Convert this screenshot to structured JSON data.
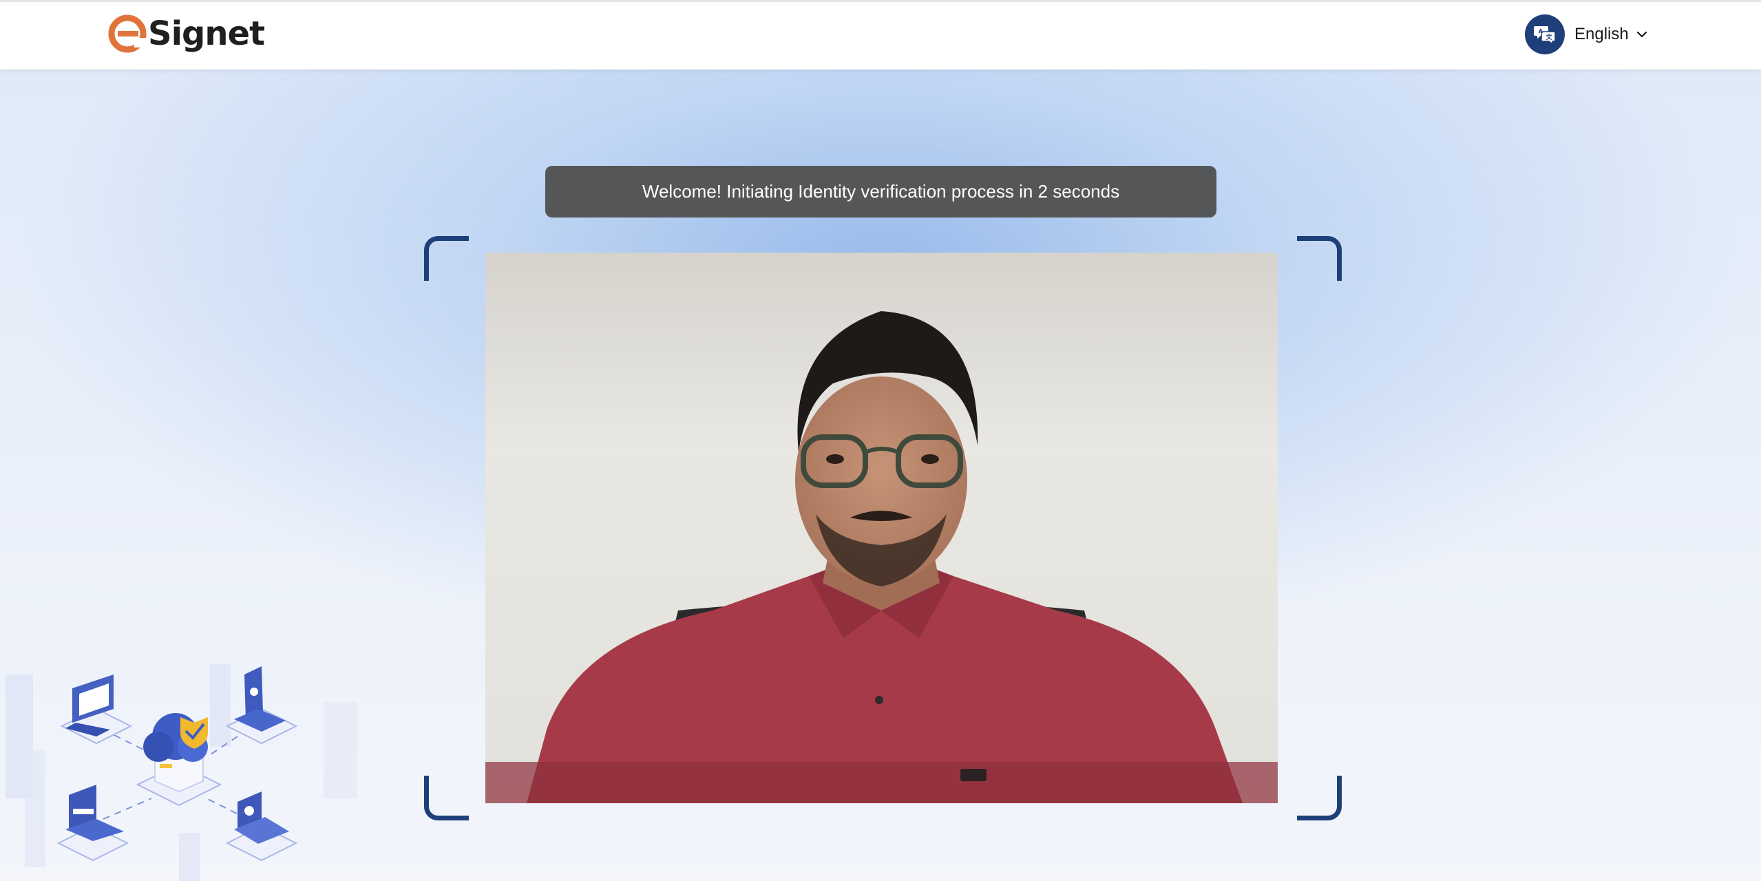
{
  "header": {
    "logo_text": "Signet",
    "language": {
      "label": "English",
      "icon": "translate-chat-icon"
    }
  },
  "banner": {
    "message": "Welcome! Initiating Identity verification process in 2 seconds"
  },
  "video": {
    "feed": "camera-feed"
  },
  "colors": {
    "brand_orange": "#e0733a",
    "brand_navy": "#1e3f7a",
    "banner_bg": "#555657"
  }
}
